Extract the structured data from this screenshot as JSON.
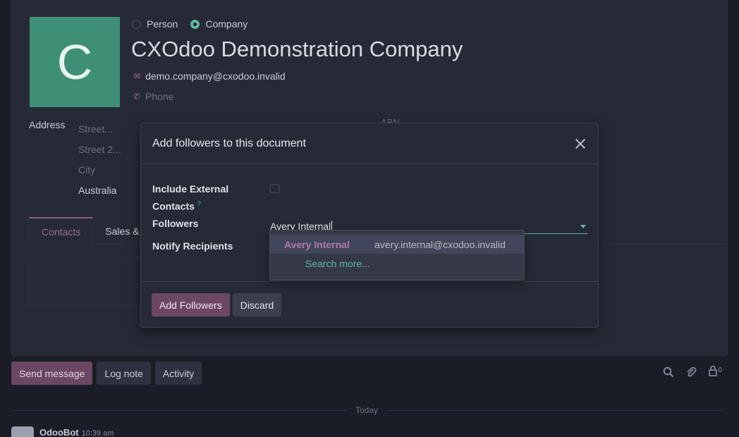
{
  "contact": {
    "avatar_letter": "C",
    "type_person": "Person",
    "type_company": "Company",
    "name": "CXOdoo Demonstration Company",
    "email": "demo.company@cxodoo.invalid",
    "phone_placeholder": "Phone",
    "address_label": "Address",
    "street_placeholder": "Street...",
    "street2_placeholder": "Street 2...",
    "city_placeholder": "City",
    "country": "Australia",
    "abn_label": "ABN"
  },
  "tabs": [
    "Contacts",
    "Sales &"
  ],
  "chatter": {
    "send_message": "Send message",
    "log_note": "Log note",
    "activity": "Activity",
    "followers_count": "0",
    "today_label": "Today",
    "author": "OdooBot",
    "time": "10:39 am"
  },
  "modal": {
    "title": "Add followers to this document",
    "include_external_label": "Include External Contacts",
    "help_mark": "?",
    "followers_label": "Followers",
    "followers_value": "Avery Internal",
    "notify_label": "Notify Recipients",
    "add_button": "Add Followers",
    "discard_button": "Discard"
  },
  "autocomplete": {
    "items": [
      {
        "name": "Avery Internal",
        "email": "avery.internal@cxodoo.invalid"
      }
    ],
    "search_more": "Search more..."
  },
  "colors": {
    "primary": "#6b4763",
    "accent": "#5fb8a1",
    "avatar_bg": "#3e8f75"
  }
}
